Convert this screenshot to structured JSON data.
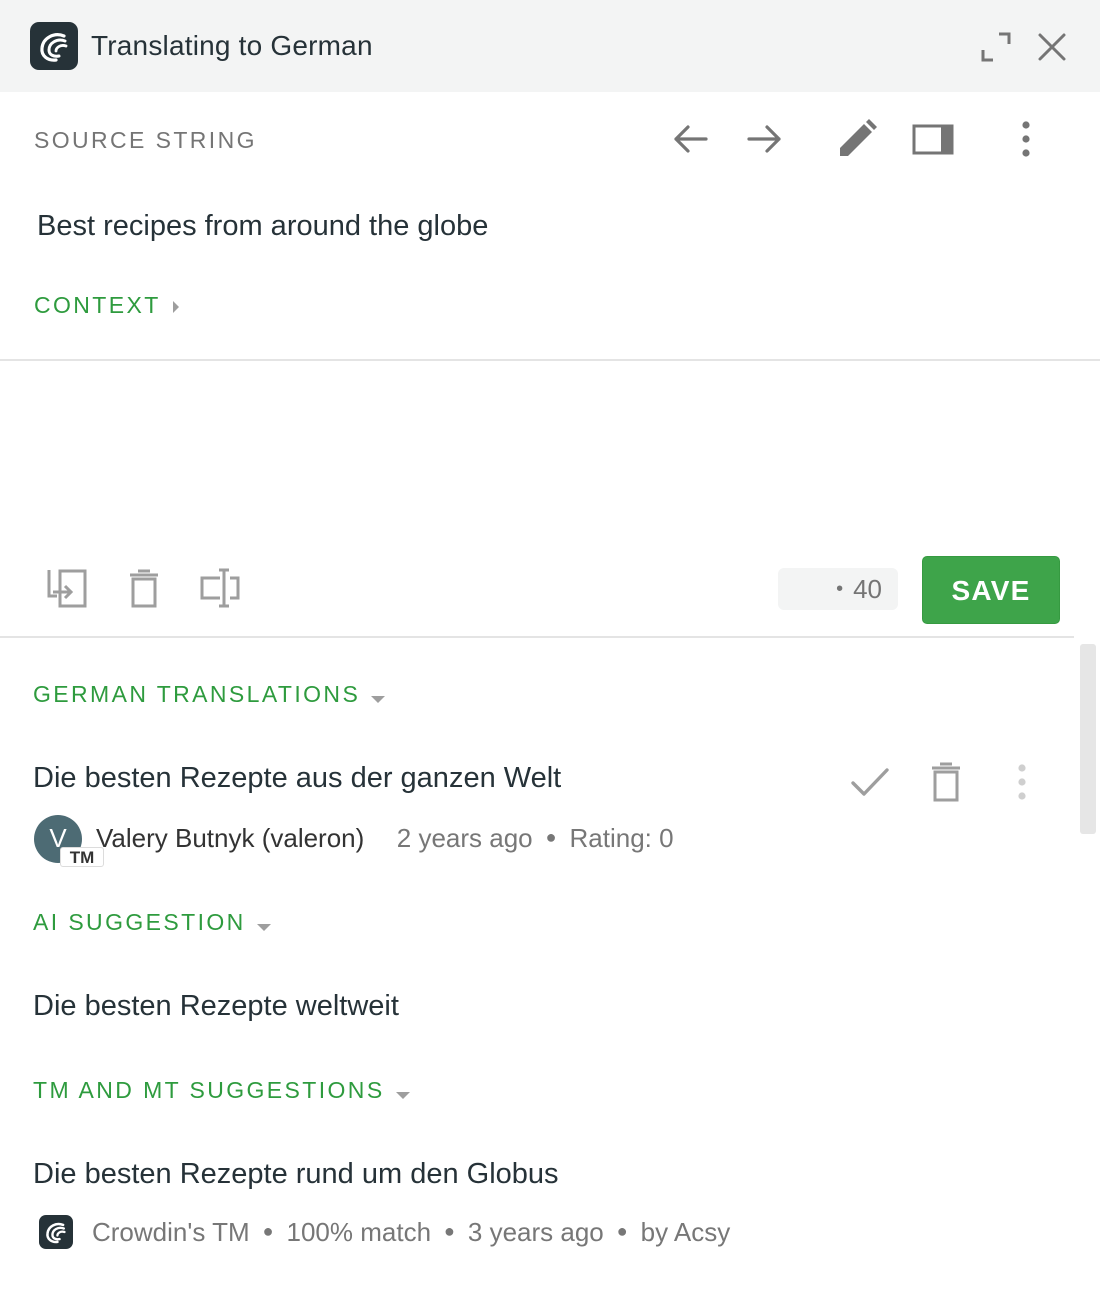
{
  "window": {
    "title": "Translating to German",
    "logo_icon": "crowdin-logo-icon",
    "buttons": [
      "expand-icon",
      "close-icon"
    ]
  },
  "source": {
    "label": "SOURCE STRING",
    "text": "Best recipes from around the globe",
    "context_label": "CONTEXT",
    "toolbar": [
      "arrow-left-icon",
      "arrow-right-icon",
      "pencil-icon",
      "split-view-icon",
      "more-vertical-icon"
    ]
  },
  "editor": {
    "value": "",
    "tools": [
      "copy-source-icon",
      "delete-icon",
      "insert-tag-icon"
    ],
    "counter": "40",
    "save_label": "SAVE"
  },
  "translations": {
    "label": "GERMAN TRANSLATIONS",
    "items": [
      {
        "text": "Die besten Rezepte aus der ganzen Welt",
        "avatar_letter": "V",
        "badge": "TM",
        "author": "Valery Butnyk (valeron)",
        "time": "2 years ago",
        "rating": "Rating: 0"
      }
    ]
  },
  "ai": {
    "label": "AI SUGGESTION",
    "text": "Die besten Rezepte weltweit"
  },
  "tm": {
    "label": "TM AND MT SUGGESTIONS",
    "items": [
      {
        "text": "Die besten Rezepte rund um den Globus",
        "source": "Crowdin's TM",
        "match": "100% match",
        "time": "3 years ago",
        "by": "by Acsy"
      }
    ]
  },
  "colors": {
    "accent_green": "#2e9b3e",
    "save_green": "#3ea44a",
    "titlebar_bg": "#f3f4f4",
    "logo_bg": "#263238"
  }
}
